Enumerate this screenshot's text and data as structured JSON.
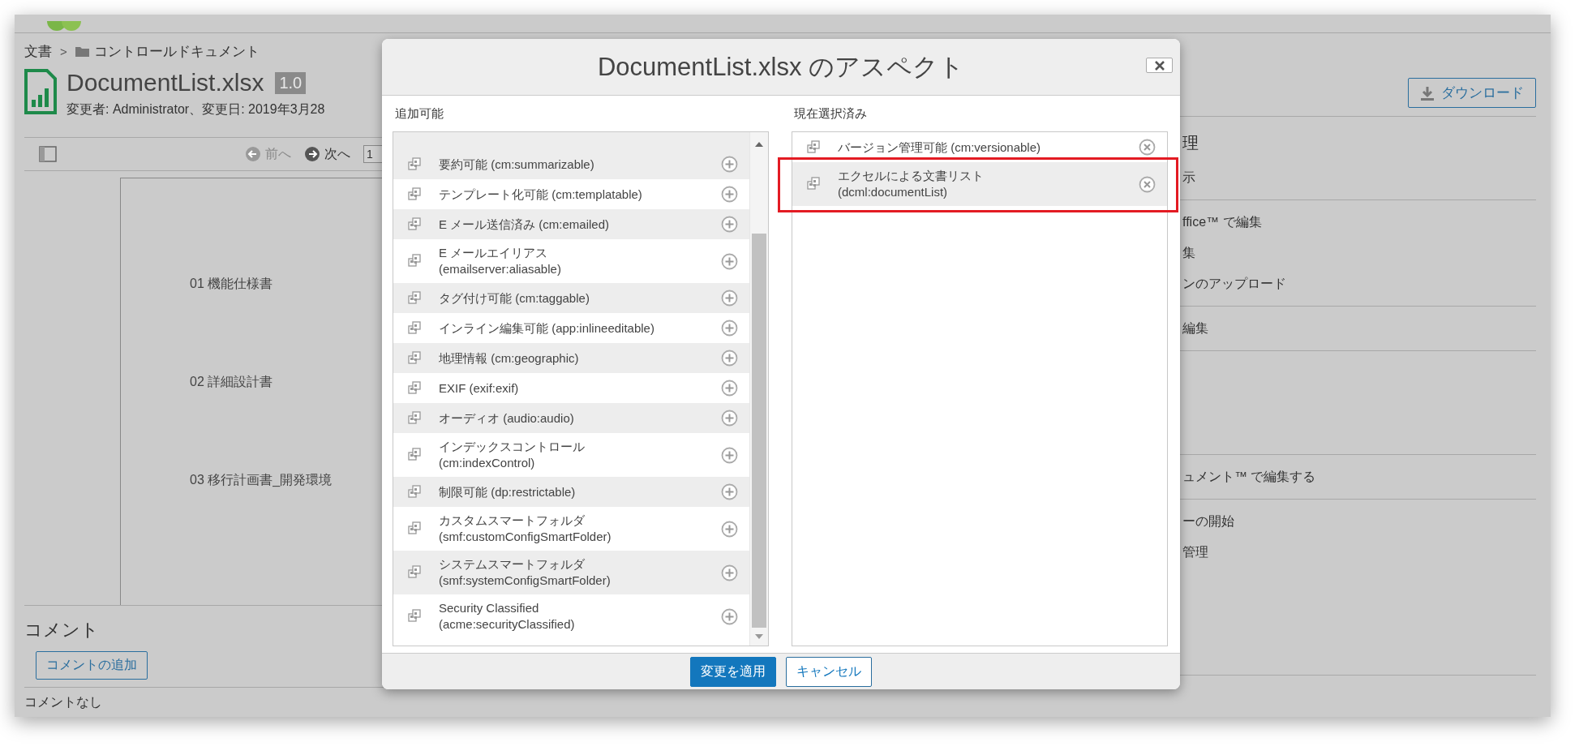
{
  "page": {
    "breadcrumb": {
      "root": "文書",
      "separator": ">",
      "folder": "コントロールドキュメント"
    },
    "title": "DocumentList.xlsx",
    "version": "1.0",
    "modified": "変更者: Administrator、変更日: 2019年3月28",
    "toolbar": {
      "prev": {
        "label": "前へ",
        "disabled": true
      },
      "next": {
        "label": "次へ",
        "disabled": false
      },
      "page": "1"
    },
    "preview_lines": [
      "01 機能仕様書",
      "02 詳細設計書",
      "03 移行計画書_開発環境"
    ],
    "comments": {
      "heading": "コメント",
      "add_button": "コメントの追加",
      "empty": "コメントなし"
    },
    "download_button": "ダウンロード",
    "action_groups": [
      {
        "items": [
          {
            "kind": "heading",
            "label": "理"
          },
          {
            "kind": "item",
            "label": "示"
          }
        ]
      },
      {
        "items": [
          {
            "kind": "item",
            "label": "ffice™ で編集"
          },
          {
            "kind": "item",
            "label": "集"
          },
          {
            "kind": "item",
            "label": "ンのアップロード"
          }
        ]
      },
      {
        "items": [
          {
            "kind": "item",
            "label": "編集"
          }
        ]
      },
      {
        "items": [
          {
            "kind": "item",
            "label": "ュメント™ で編集する"
          }
        ]
      },
      {
        "items": [
          {
            "kind": "item",
            "label": "ーの開始"
          },
          {
            "kind": "item",
            "label": "管理"
          }
        ]
      }
    ]
  },
  "dialog": {
    "title": "DocumentList.xlsx のアスペクト",
    "available": {
      "heading": "追加可能",
      "items": [
        {
          "lines": [
            "要約可能 (cm:summarizable)"
          ]
        },
        {
          "lines": [
            "テンプレート化可能 (cm:templatable)"
          ]
        },
        {
          "lines": [
            "E メール送信済み (cm:emailed)"
          ]
        },
        {
          "lines": [
            "E メールエイリアス",
            "(emailserver:aliasable)"
          ]
        },
        {
          "lines": [
            "タグ付け可能 (cm:taggable)"
          ]
        },
        {
          "lines": [
            "インライン編集可能 (app:inlineeditable)"
          ]
        },
        {
          "lines": [
            "地理情報 (cm:geographic)"
          ]
        },
        {
          "lines": [
            "EXIF (exif:exif)"
          ]
        },
        {
          "lines": [
            "オーディオ (audio:audio)"
          ]
        },
        {
          "lines": [
            "インデックスコントロール",
            "(cm:indexControl)"
          ]
        },
        {
          "lines": [
            "制限可能 (dp:restrictable)"
          ]
        },
        {
          "lines": [
            "カスタムスマートフォルダ",
            "(smf:customConfigSmartFolder)"
          ]
        },
        {
          "lines": [
            "システムスマートフォルダ",
            "(smf:systemConfigSmartFolder)"
          ]
        },
        {
          "lines": [
            "Security Classified",
            "(acme:securityClassified)"
          ]
        }
      ]
    },
    "selected": {
      "heading": "現在選択済み",
      "items": [
        {
          "lines": [
            "バージョン管理可能 (cm:versionable)"
          ],
          "highlighted": false
        },
        {
          "lines": [
            "エクセルによる文書リスト",
            "(dcml:documentList)"
          ],
          "highlighted": true
        }
      ]
    },
    "buttons": [
      {
        "label": "変更を適用",
        "kind": "primary"
      },
      {
        "label": "キャンセル",
        "kind": "secondary"
      }
    ]
  }
}
